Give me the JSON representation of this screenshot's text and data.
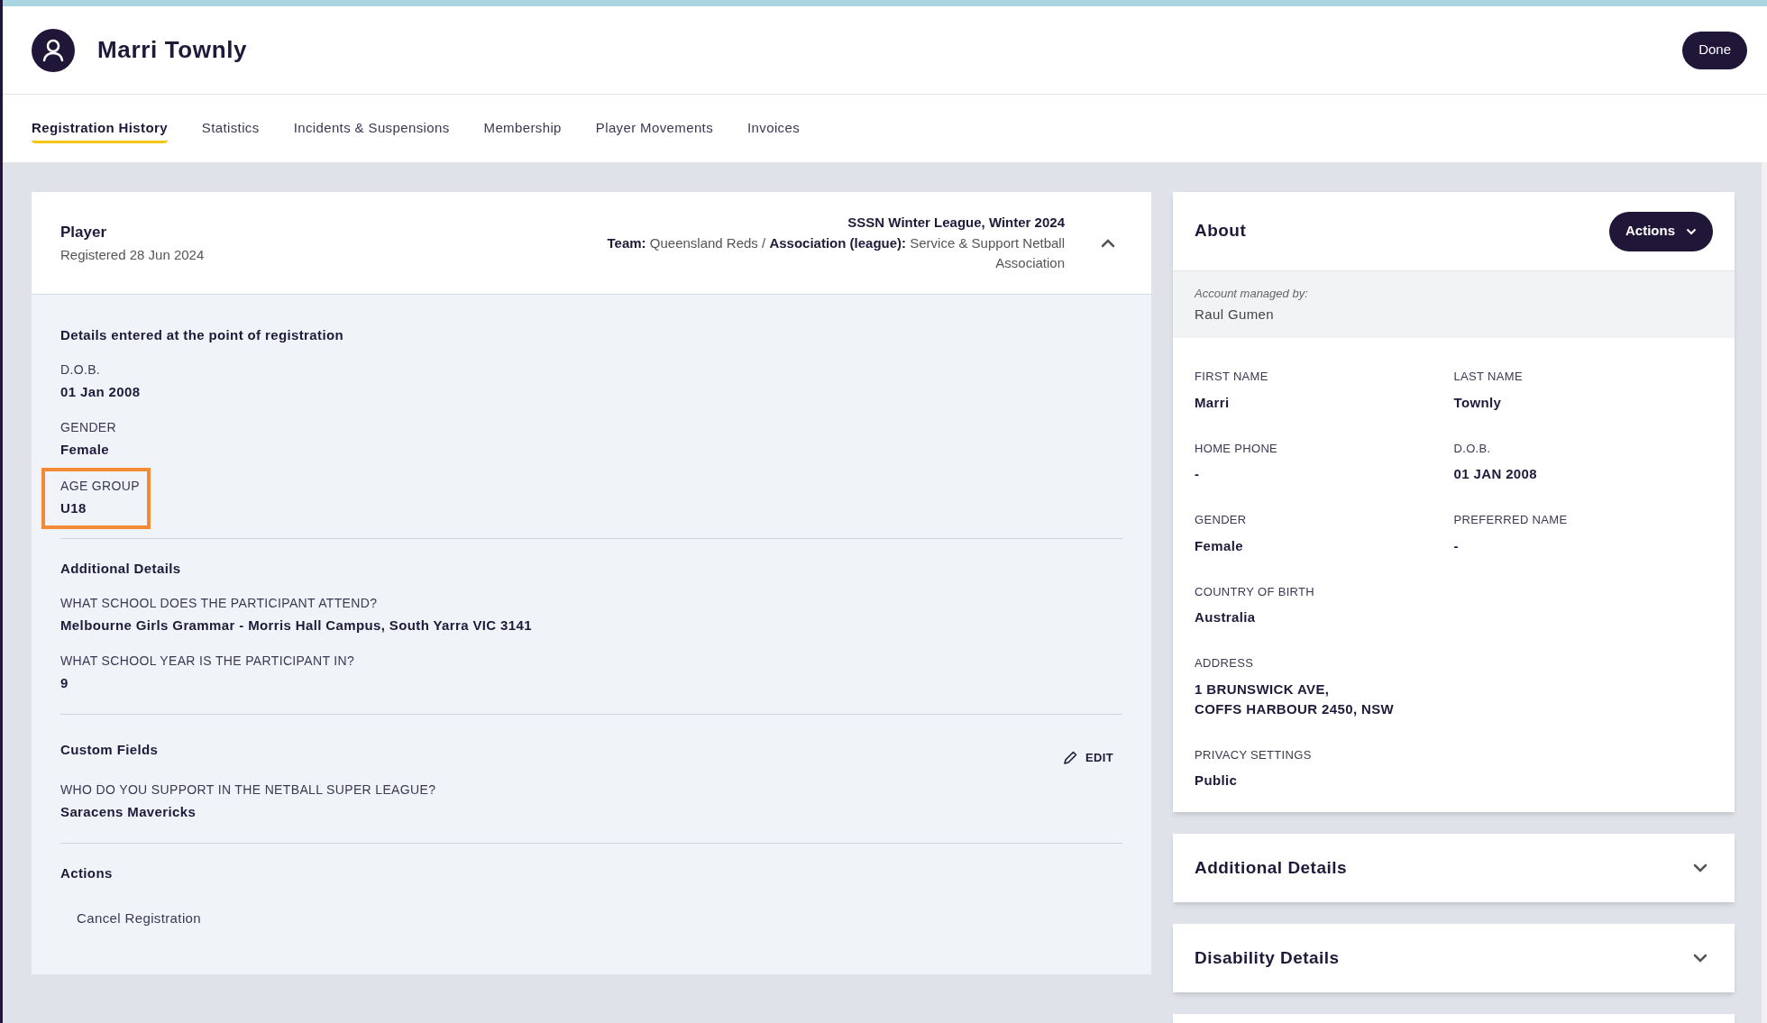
{
  "header": {
    "title": "Marri Townly",
    "done_button": "Done"
  },
  "tabs": [
    {
      "label": "Registration History",
      "selected": true
    },
    {
      "label": "Statistics",
      "selected": false
    },
    {
      "label": "Incidents & Suspensions",
      "selected": false
    },
    {
      "label": "Membership",
      "selected": false
    },
    {
      "label": "Player Movements",
      "selected": false
    },
    {
      "label": "Invoices",
      "selected": false
    }
  ],
  "registration": {
    "title": "Player",
    "subtitle": "Registered 28 Jun 2024",
    "competition": "SSSN Winter League, Winter 2024",
    "team_line": "**Team:** Queensland Reds / **Association (league):** Service & Support Netball Association",
    "expanded": true,
    "sections": [
      {
        "heading": "Details entered at the point of registration",
        "fields": [
          {
            "label": "D.O.B.",
            "value": "01 Jan 2008",
            "highlighted": false
          },
          {
            "label": "GENDER",
            "value": "Female",
            "highlighted": false
          },
          {
            "label": "AGE GROUP",
            "value": "U18",
            "highlighted": true
          }
        ]
      },
      {
        "heading": "Additional Details",
        "fields": [
          {
            "label": "WHAT SCHOOL DOES THE PARTICIPANT ATTEND?",
            "value": "Melbourne Girls Grammar - Morris Hall Campus, South Yarra VIC 3141",
            "highlighted": false
          },
          {
            "label": "WHAT SCHOOL YEAR IS THE PARTICIPANT IN?",
            "value": "9",
            "highlighted": false
          }
        ]
      },
      {
        "heading": "Custom Fields",
        "edit_button": "EDIT",
        "fields": [
          {
            "label": "WHO DO YOU SUPPORT IN THE NETBALL SUPER LEAGUE?",
            "value": "Saracens Mavericks",
            "highlighted": false
          }
        ]
      },
      {
        "heading": "Actions",
        "actions": [
          "Cancel Registration"
        ]
      }
    ]
  },
  "about": {
    "title": "About",
    "actions_button": "Actions",
    "managed_by_label": "Account managed by:",
    "managed_by": "Raul Gumen",
    "fields": [
      {
        "label": "FIRST NAME",
        "value": "Marri",
        "full_row": false
      },
      {
        "label": "LAST NAME",
        "value": "Townly",
        "full_row": false
      },
      {
        "label": "HOME PHONE",
        "value": "-",
        "full_row": false
      },
      {
        "label": "D.O.B.",
        "value": "01 JAN 2008",
        "full_row": false
      },
      {
        "label": "GENDER",
        "value": "Female",
        "full_row": false
      },
      {
        "label": "PREFERRED NAME",
        "value": "-",
        "full_row": false
      },
      {
        "label": "COUNTRY OF BIRTH",
        "value": "Australia",
        "full_row": true
      },
      {
        "label": "ADDRESS",
        "value": "1 BRUNSWICK AVE,\nCOFFS HARBOUR 2450, NSW",
        "full_row": true
      },
      {
        "label": "PRIVACY SETTINGS",
        "value": "Public",
        "full_row": true
      }
    ]
  },
  "collapsed_panels": [
    {
      "title": "Additional Details",
      "expanded": false
    },
    {
      "title": "Disability Details",
      "expanded": false
    }
  ]
}
